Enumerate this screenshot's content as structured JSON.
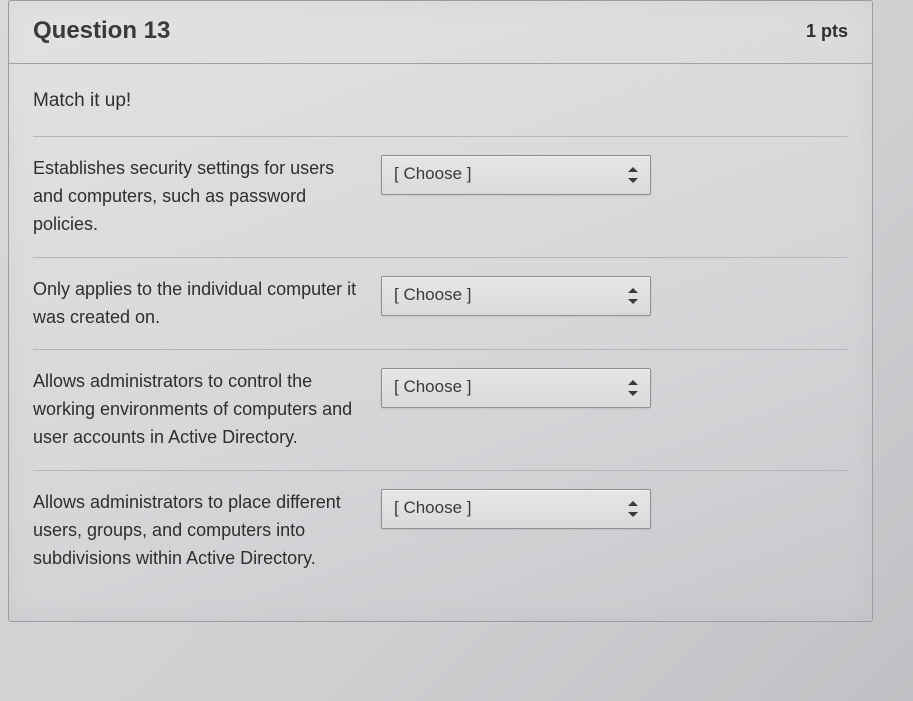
{
  "header": {
    "title": "Question 13",
    "points": "1 pts"
  },
  "instructions": "Match it up!",
  "select_placeholder": "[ Choose ]",
  "rows": [
    {
      "prompt": "Establishes security settings for users and computers, such as password policies.",
      "value": "[ Choose ]"
    },
    {
      "prompt": "Only applies to the individual computer it was created on.",
      "value": "[ Choose ]"
    },
    {
      "prompt": "Allows administrators to control the working environments of computers and user accounts in Active Directory.",
      "value": "[ Choose ]"
    },
    {
      "prompt": "Allows administrators to place different users, groups, and computers into subdivisions within Active Directory.",
      "value": "[ Choose ]"
    }
  ]
}
